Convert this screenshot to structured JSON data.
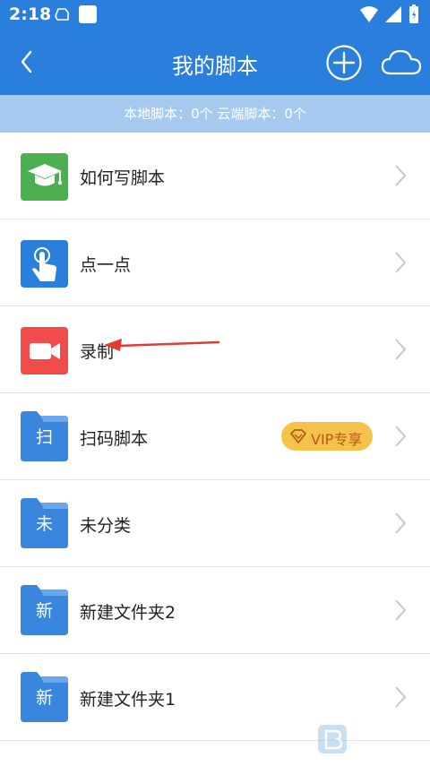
{
  "status_bar": {
    "time": "2:18"
  },
  "header": {
    "title": "我的脚本"
  },
  "summary": {
    "text": "本地脚本：0个  云端脚本：0个"
  },
  "list": {
    "items": [
      {
        "label": "如何写脚本",
        "icon": "graduation-cap-icon",
        "icon_bg": "#4caf50"
      },
      {
        "label": "点一点",
        "icon": "tap-hand-icon",
        "icon_bg": "#2a7fdc"
      },
      {
        "label": "录制",
        "icon": "video-camera-icon",
        "icon_bg": "#f24b4b"
      },
      {
        "label": "扫码脚本",
        "icon": "folder-icon",
        "folder_letter": "扫",
        "badge": "VIP专享"
      },
      {
        "label": "未分类",
        "icon": "folder-icon",
        "folder_letter": "未"
      },
      {
        "label": "新建文件夹2",
        "icon": "folder-icon",
        "folder_letter": "新"
      },
      {
        "label": "新建文件夹1",
        "icon": "folder-icon",
        "folder_letter": "新"
      }
    ]
  },
  "colors": {
    "primary": "#2a7fdc",
    "summary_bg": "#a5c9ef",
    "vip_bg": "#f5c34a",
    "vip_text": "#b55a14",
    "annotation_arrow": "#e53935"
  }
}
